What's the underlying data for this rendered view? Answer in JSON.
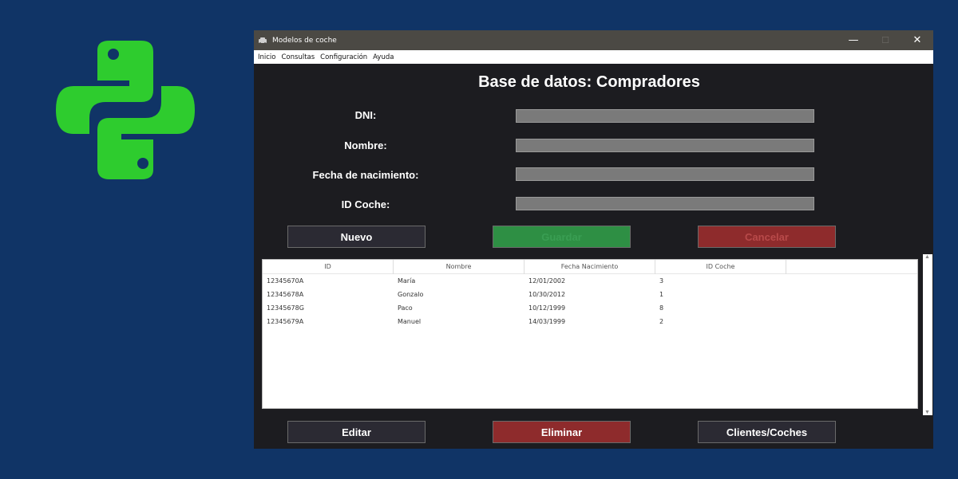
{
  "window": {
    "title": "Modelos de coche",
    "controls": {
      "minimize": "—",
      "maximize": "☐",
      "close": "✕"
    }
  },
  "menu": [
    "Inicio",
    "Consultas",
    "Configuración",
    "Ayuda"
  ],
  "heading": "Base de datos: Compradores",
  "form": {
    "dni_label": "DNI:",
    "nombre_label": "Nombre:",
    "fecha_label": "Fecha de nacimiento:",
    "idcoche_label": "ID Coche:",
    "dni_value": "",
    "nombre_value": "",
    "fecha_value": "",
    "idcoche_value": ""
  },
  "buttons": {
    "nuevo": "Nuevo",
    "guardar": "Guardar",
    "cancelar": "Cancelar",
    "editar": "Editar",
    "eliminar": "Eliminar",
    "clientes_coches": "Clientes/Coches"
  },
  "table": {
    "columns": [
      "ID",
      "Nombre",
      "Fecha Nacimiento",
      "ID Coche"
    ],
    "rows": [
      [
        "12345670A",
        "María",
        "12/01/2002",
        "3"
      ],
      [
        "12345678A",
        "Gonzalo",
        "10/30/2012",
        "1"
      ],
      [
        "12345678G",
        "Paco",
        "10/12/1999",
        "8"
      ],
      [
        "12345679A",
        "Manuel",
        "14/03/1999",
        "2"
      ]
    ]
  },
  "colors": {
    "background": "#103466",
    "python_logo": "#2ecc2e",
    "window_bg": "#1c1c20",
    "btn_green": "#2e8f44",
    "btn_red": "#8e2b2c"
  }
}
